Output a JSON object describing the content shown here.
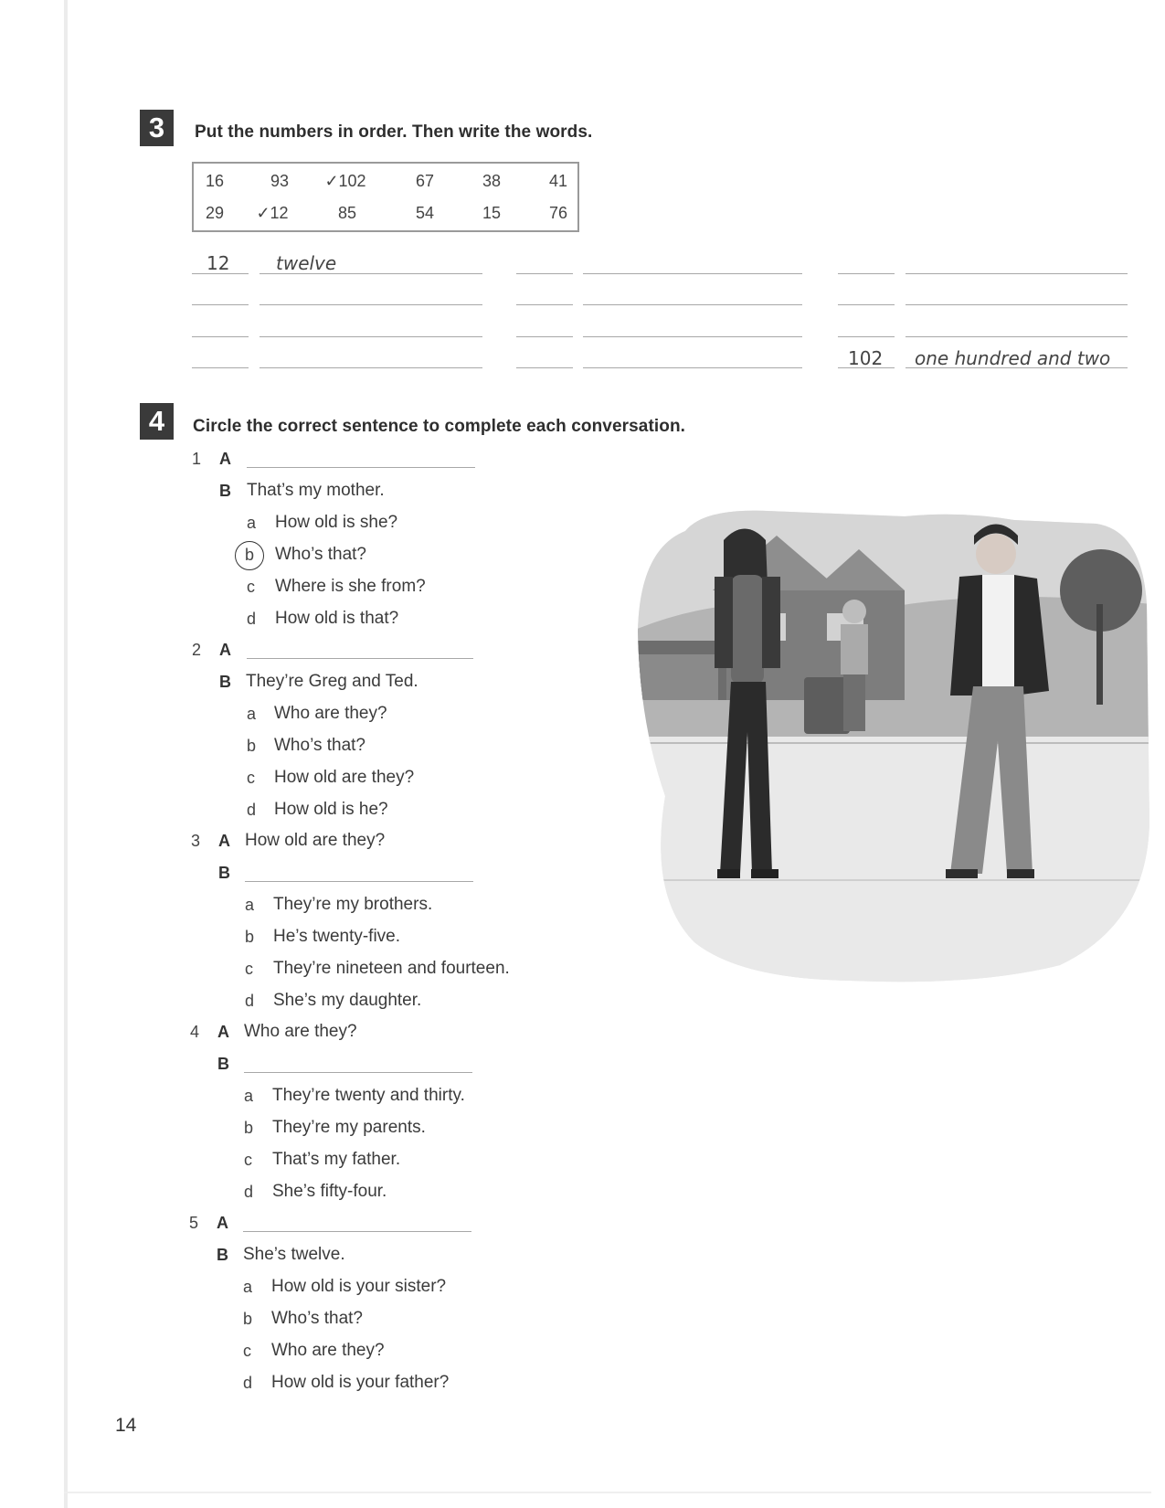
{
  "ex3": {
    "number": "3",
    "instruction": "Put the numbers in order. Then write the words.",
    "box_row1": [
      "16",
      "93",
      "✓102",
      "67",
      "38",
      "41"
    ],
    "box_row2": [
      "29",
      "✓12",
      "85",
      "54",
      "15",
      "76"
    ],
    "example_first": {
      "number": "12",
      "word": "twelve"
    },
    "example_last": {
      "number": "102",
      "word": "one hundred and two"
    }
  },
  "ex4": {
    "number": "4",
    "instruction": "Circle the correct sentence to complete each conversation.",
    "items": [
      {
        "n": "1",
        "a_label": "A",
        "a_text": "",
        "b_label": "B",
        "b_text": "That’s my mother.",
        "options": [
          {
            "l": "a",
            "t": "How old is she?"
          },
          {
            "l": "b",
            "t": "Who’s that?"
          },
          {
            "l": "c",
            "t": "Where is she from?"
          },
          {
            "l": "d",
            "t": "How old is that?"
          }
        ]
      },
      {
        "n": "2",
        "a_label": "A",
        "a_text": "",
        "b_label": "B",
        "b_text": "They’re Greg and Ted.",
        "options": [
          {
            "l": "a",
            "t": "Who are they?"
          },
          {
            "l": "b",
            "t": "Who’s that?"
          },
          {
            "l": "c",
            "t": "How old are they?"
          },
          {
            "l": "d",
            "t": "How old is he?"
          }
        ]
      },
      {
        "n": "3",
        "a_label": "A",
        "a_text": "How old are they?",
        "b_label": "B",
        "b_text": "",
        "options": [
          {
            "l": "a",
            "t": "They’re my brothers."
          },
          {
            "l": "b",
            "t": "He’s twenty-five."
          },
          {
            "l": "c",
            "t": "They’re nineteen and fourteen."
          },
          {
            "l": "d",
            "t": "She’s my daughter."
          }
        ]
      },
      {
        "n": "4",
        "a_label": "A",
        "a_text": "Who are they?",
        "b_label": "B",
        "b_text": "",
        "options": [
          {
            "l": "a",
            "t": "They’re twenty and thirty."
          },
          {
            "l": "b",
            "t": "They’re my parents."
          },
          {
            "l": "c",
            "t": "That’s my father."
          },
          {
            "l": "d",
            "t": "She’s fifty-four."
          }
        ]
      },
      {
        "n": "5",
        "a_label": "A",
        "a_text": "",
        "b_label": "B",
        "b_text": "She’s twelve.",
        "options": [
          {
            "l": "a",
            "t": "How old is your sister?"
          },
          {
            "l": "b",
            "t": "Who’s that?"
          },
          {
            "l": "c",
            "t": "Who are they?"
          },
          {
            "l": "d",
            "t": "How old is your father?"
          }
        ]
      }
    ]
  },
  "page_number": "14"
}
